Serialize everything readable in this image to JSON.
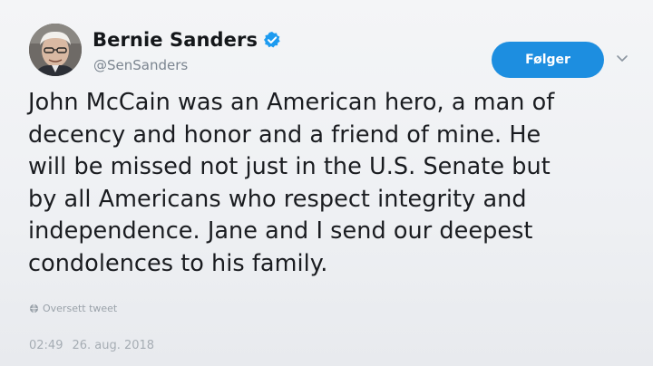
{
  "user": {
    "display_name": "Bernie Sanders",
    "handle": "@SenSanders",
    "verified": true
  },
  "follow_button": {
    "label": "Følger",
    "color": "#1d8ee0"
  },
  "menu": {
    "icon": "chevron-down-icon"
  },
  "tweet": {
    "lines": [
      "John McCain was an American hero, a man of",
      "decency and honor and a friend of mine. He",
      "will be missed not just in the U.S. Senate but",
      "by all Americans who respect integrity and",
      "independence. Jane and I send our deepest",
      "condolences to his family."
    ]
  },
  "translate": {
    "icon": "globe-icon",
    "label": "Oversett tweet"
  },
  "meta": {
    "time": "02:49",
    "date": "26. aug. 2018"
  }
}
